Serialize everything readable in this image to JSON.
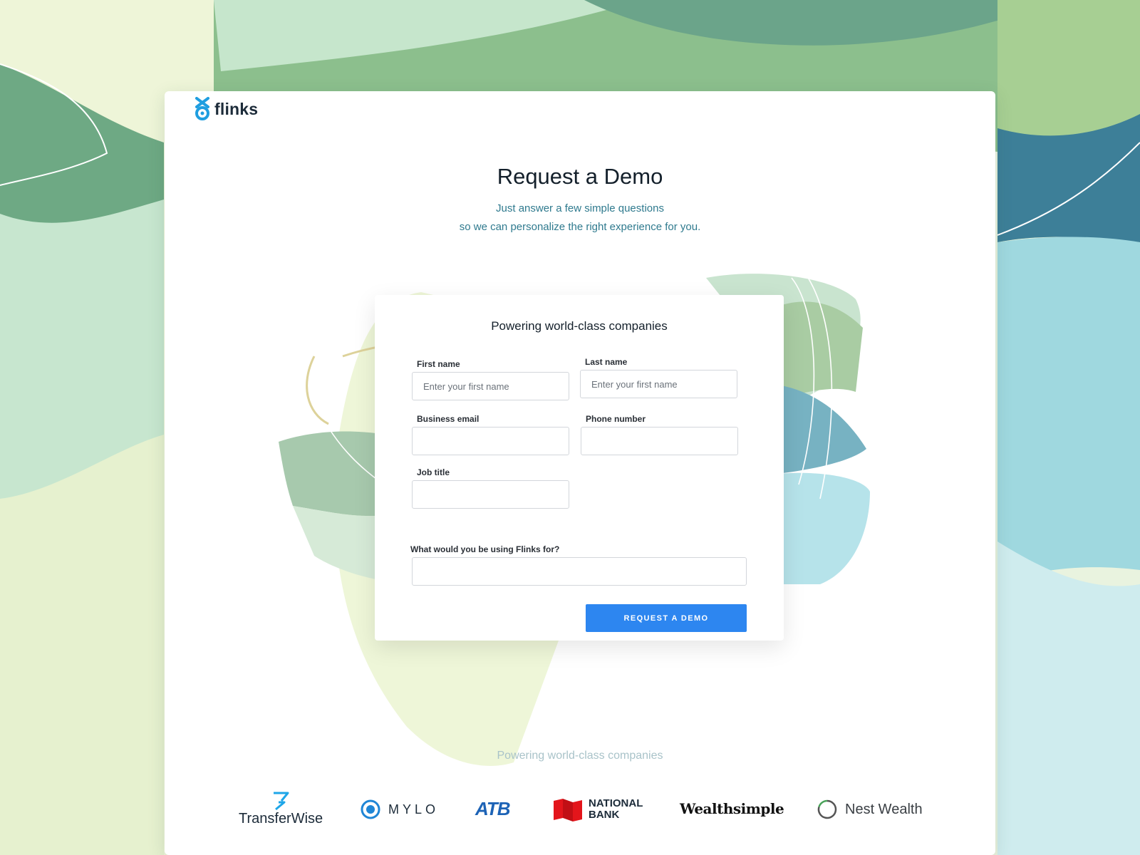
{
  "brand": {
    "name": "flinks",
    "accent": "#2d86f0",
    "icon": "flinks-logo-icon"
  },
  "hero": {
    "title": "Request a Demo",
    "subtitle_line1": "Just answer a few simple questions",
    "subtitle_line2": "so we can personalize the right experience for you."
  },
  "form": {
    "title": "Powering world-class companies",
    "first_name": {
      "label": "First name",
      "placeholder": "Enter your first name",
      "value": ""
    },
    "last_name": {
      "label": "Last name",
      "placeholder": "Enter your first name",
      "value": ""
    },
    "business_email": {
      "label": "Business email",
      "placeholder": "",
      "value": ""
    },
    "phone_number": {
      "label": "Phone number",
      "placeholder": "",
      "value": ""
    },
    "job_title": {
      "label": "Job title",
      "placeholder": "",
      "value": ""
    },
    "usage": {
      "label": "What would you be using Flinks for?",
      "placeholder": "",
      "value": ""
    },
    "submit_label": "REQUEST A DEMO"
  },
  "partners": {
    "title": "Powering world-class companies",
    "logos": [
      {
        "name": "TransferWise",
        "icon": "transferwise-logo-icon"
      },
      {
        "name": "MYLO",
        "icon": "mylo-logo-icon"
      },
      {
        "name": "ATB",
        "icon": "atb-logo"
      },
      {
        "name_line1": "NATIONAL",
        "name_line2": "BANK",
        "icon": "national-bank-logo-icon"
      },
      {
        "name": "Wealthsimple",
        "icon": "wealthsimple-logo"
      },
      {
        "name": "Nest Wealth",
        "icon": "nest-wealth-logo-icon"
      }
    ]
  },
  "colors": {
    "title_text": "#14202b",
    "subtitle_text": "#2f7a8e",
    "button_bg": "#2d86f0",
    "transferwise_blue": "#1ea6e8",
    "mylo_blue": "#1f86d6",
    "atb_blue": "#1d63b6",
    "national_bank_red": "#e3151b",
    "nest_green": "#4aa35a"
  }
}
